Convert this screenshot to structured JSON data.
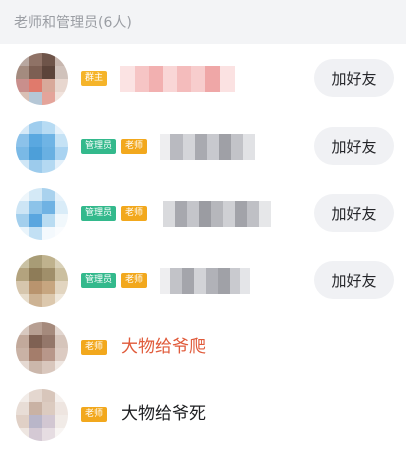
{
  "section": {
    "title": "老师和管理员(6人)"
  },
  "members": [
    {
      "badges": [
        {
          "label": "群主",
          "kind": "owner"
        }
      ],
      "name": "",
      "name_color": "#ec7c7c",
      "add_button": "加好友"
    },
    {
      "badges": [
        {
          "label": "管理员",
          "kind": "admin"
        },
        {
          "label": "老师",
          "kind": "teacher"
        }
      ],
      "name": "",
      "name_color": "#9fa0a6",
      "add_button": "加好友"
    },
    {
      "badges": [
        {
          "label": "管理员",
          "kind": "admin"
        },
        {
          "label": "老师",
          "kind": "teacher"
        }
      ],
      "name": "",
      "name_color": "#9fa0a6",
      "add_button": "加好友"
    },
    {
      "badges": [
        {
          "label": "管理员",
          "kind": "admin"
        },
        {
          "label": "老师",
          "kind": "teacher"
        }
      ],
      "name": "",
      "name_color": "#9fa0a6",
      "add_button": "加好友"
    },
    {
      "badges": [
        {
          "label": "老师",
          "kind": "teacher"
        }
      ],
      "name": "大物给爷爬",
      "name_color": "#e05a3a",
      "add_button": ""
    },
    {
      "badges": [
        {
          "label": "老师",
          "kind": "teacher"
        }
      ],
      "name": "大物给爷死",
      "name_color": "#1e1f22",
      "add_button": ""
    }
  ]
}
